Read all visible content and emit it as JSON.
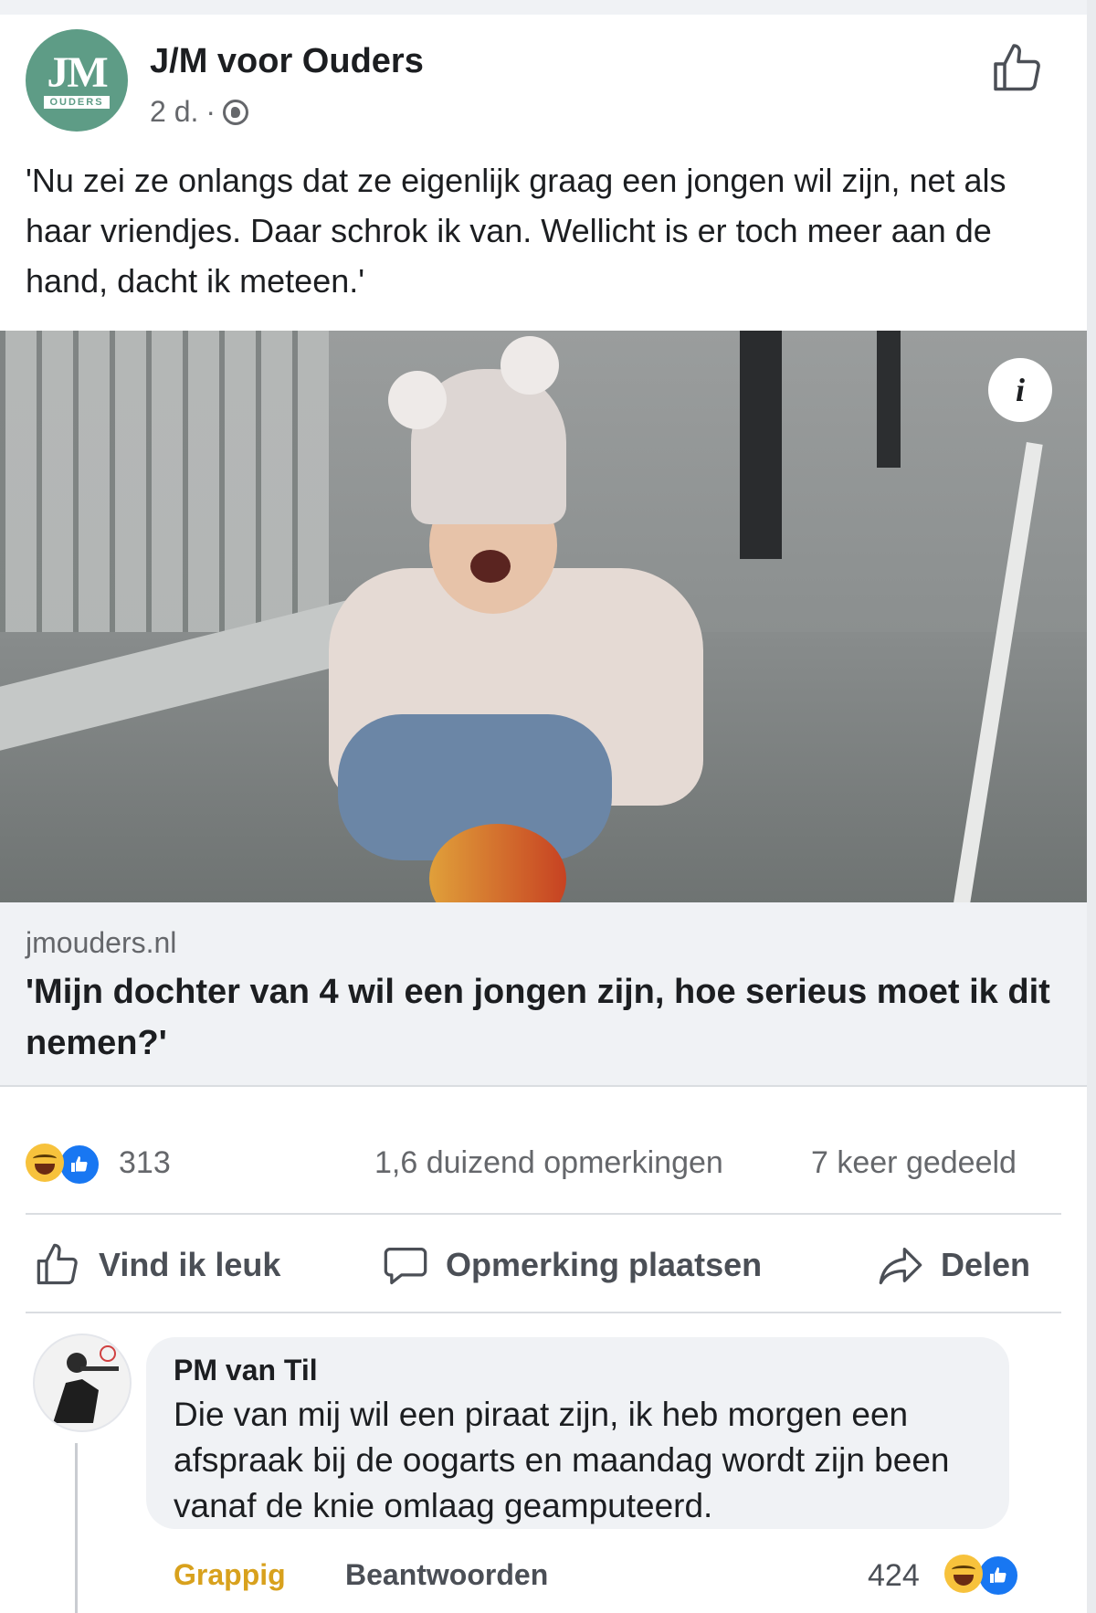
{
  "post": {
    "page_name": "J/M voor Ouders",
    "avatar_text": "JM",
    "avatar_subtext": "OUDERS",
    "time": "2 d.",
    "separator": "·",
    "text": "'Nu zei ze onlangs dat ze eigenlijk graag een jongen wil zijn, net als haar vriendjes. Daar schrok ik van. Wellicht is er toch meer aan de hand, dacht ik meteen.'",
    "info_icon": "i"
  },
  "link": {
    "domain": "jmouders.nl",
    "title": "'Mijn dochter van 4 wil een jongen zijn, hoe serieus moet ik dit nemen?'"
  },
  "stats": {
    "reactions_count": "313",
    "comments": "1,6 duizend opmerkingen",
    "shares": "7 keer gedeeld"
  },
  "actions": {
    "like": "Vind ik leuk",
    "comment": "Opmerking plaatsen",
    "share": "Delen"
  },
  "comment": {
    "author": "PM van Til",
    "text": "Die van mij wil een piraat zijn, ik heb morgen een afspraak bij de oogarts en maandag wordt zijn been vanaf de knie omlaag geamputeerd.",
    "reaction_label": "Grappig",
    "reply_label": "Beantwoorden",
    "reactions_count": "424"
  },
  "colors": {
    "accent": "#1877f2",
    "haha": "#f7c23c",
    "grappig": "#d8a11d",
    "muted": "#65676b"
  },
  "icons": [
    "thumbs-up-icon",
    "globe-icon",
    "info-icon",
    "haha-reaction-icon",
    "like-reaction-icon",
    "comment-icon",
    "share-icon"
  ]
}
